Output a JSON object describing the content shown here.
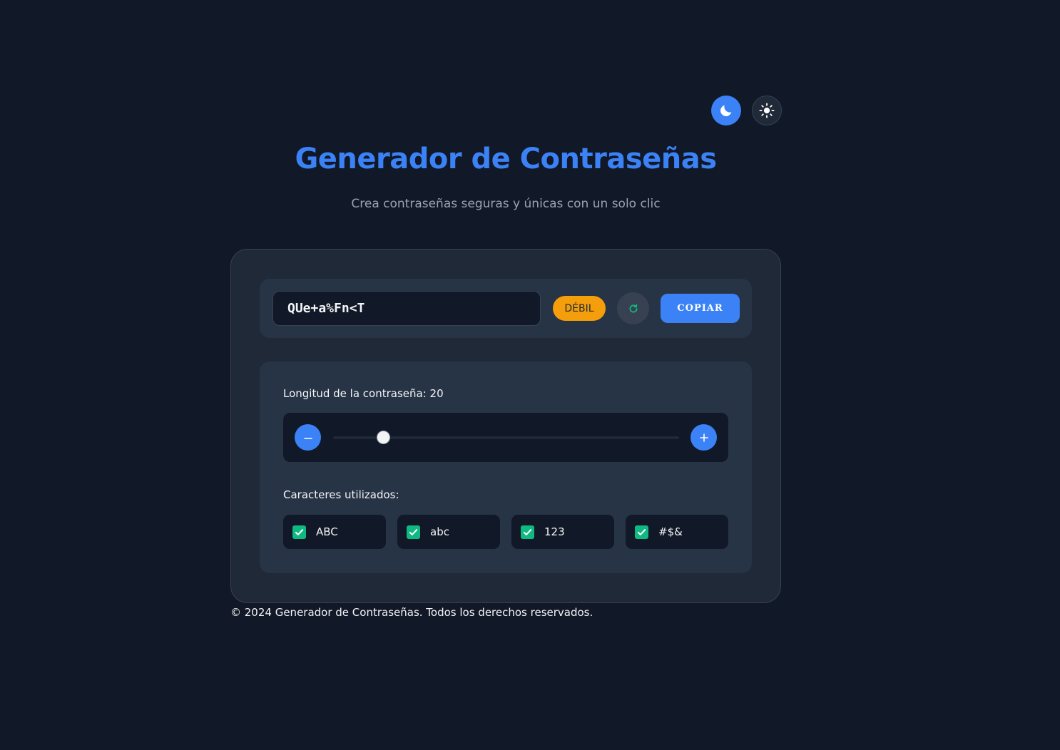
{
  "theme": {
    "dark_icon": "moon-icon",
    "light_icon": "sun-icon",
    "active": "dark"
  },
  "header": {
    "title": "Generador de Contraseñas",
    "subtitle": "Crea contraseñas seguras y únicas con un solo clic"
  },
  "generator": {
    "password": "QUe+a%Fn<T",
    "strength": "DÉBIL",
    "strength_color": "#f59e0b",
    "refresh_icon": "refresh-icon",
    "copy_label": "COPIAR"
  },
  "settings": {
    "length_label": "Longitud de la contraseña: 20",
    "length_value": 20,
    "decrement_icon": "minus-icon",
    "increment_icon": "plus-icon",
    "chars_label": "Caracteres utilizados:",
    "options": [
      {
        "label": "ABC",
        "checked": true
      },
      {
        "label": "abc",
        "checked": true
      },
      {
        "label": "123",
        "checked": true
      },
      {
        "label": "#$&",
        "checked": true
      }
    ]
  },
  "footer": {
    "text": "© 2024 Generador de Contraseñas. Todos los derechos reservados."
  },
  "colors": {
    "accent": "#3b82f6",
    "background": "#111827",
    "card": "#1f2937",
    "check": "#10b981",
    "weak": "#f59e0b"
  }
}
